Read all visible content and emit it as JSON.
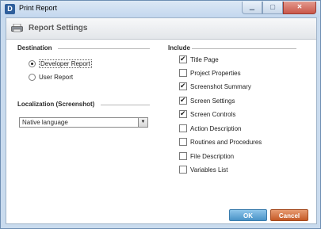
{
  "window": {
    "title": "Print Report",
    "app_icon": "D"
  },
  "header": {
    "title": "Report Settings"
  },
  "destination": {
    "label": "Destination",
    "options": [
      {
        "label": "Developer Report",
        "selected": true
      },
      {
        "label": "User Report",
        "selected": false
      }
    ]
  },
  "localization": {
    "label": "Localization (Screenshot)",
    "value": "Native language"
  },
  "include": {
    "label": "Include",
    "items": [
      {
        "label": "Title Page",
        "checked": true
      },
      {
        "label": "Project Properties",
        "checked": false
      },
      {
        "label": "Screenshot Summary",
        "checked": true
      },
      {
        "label": "Screen Settings",
        "checked": true
      },
      {
        "label": "Screen Controls",
        "checked": true
      },
      {
        "label": "Action Description",
        "checked": false
      },
      {
        "label": "Routines and Procedures",
        "checked": false
      },
      {
        "label": "File Description",
        "checked": false
      },
      {
        "label": "Variables List",
        "checked": false
      }
    ]
  },
  "buttons": {
    "ok": "OK",
    "cancel": "Cancel"
  }
}
